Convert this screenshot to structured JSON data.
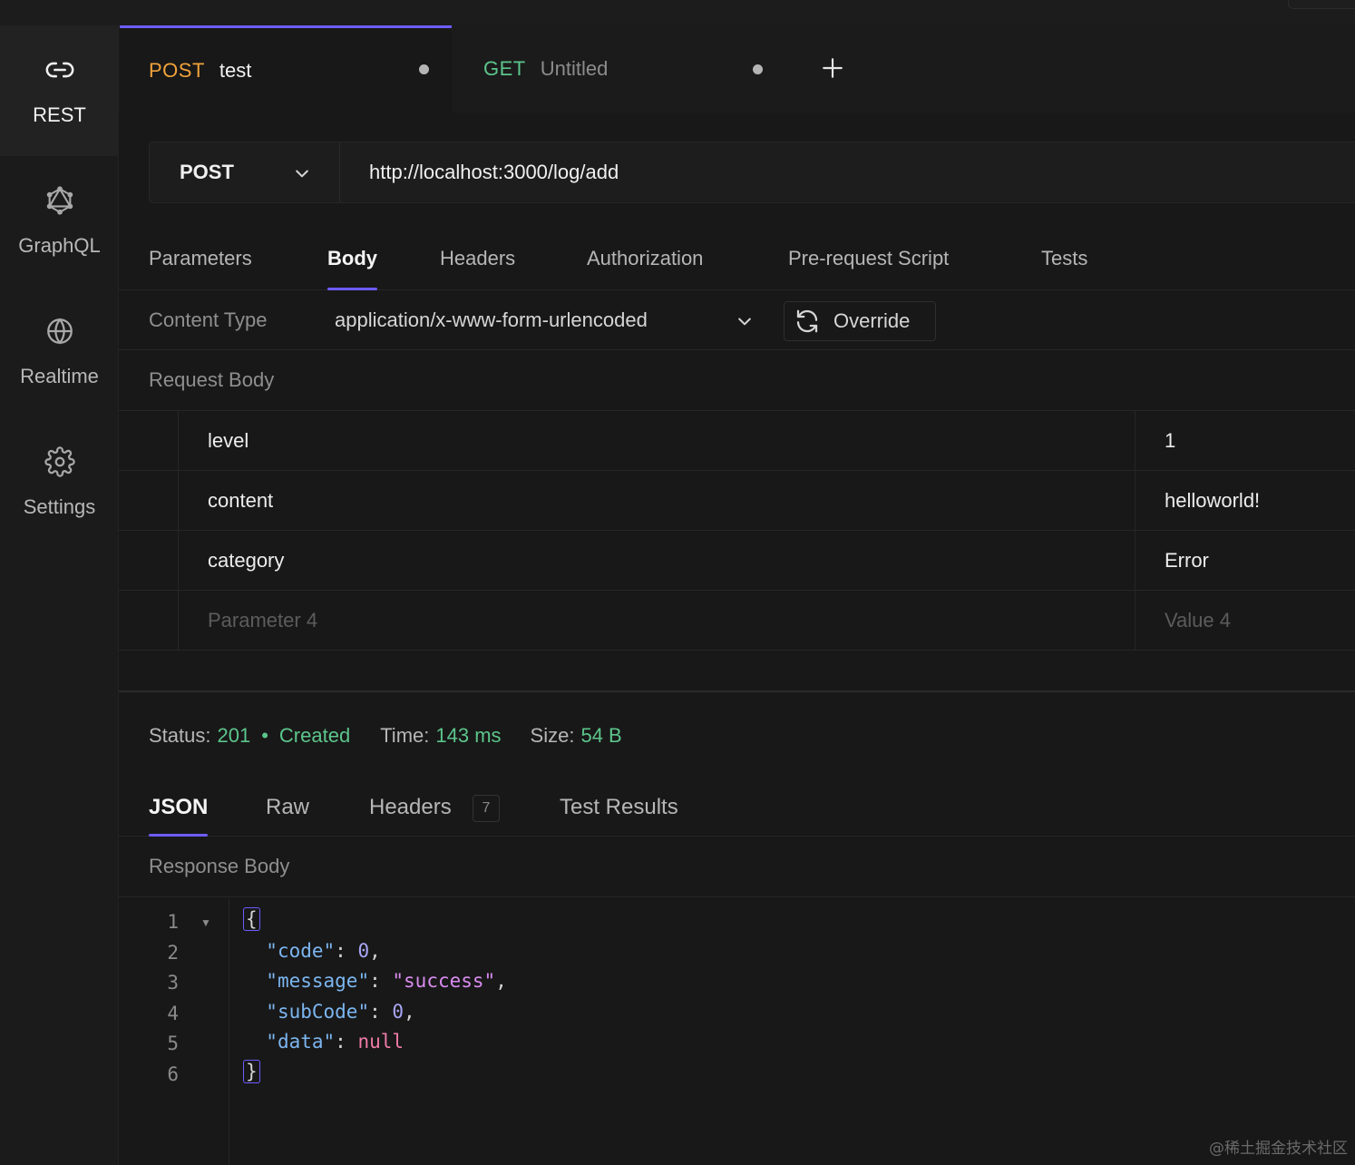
{
  "sidebar": {
    "items": [
      {
        "label": "REST",
        "icon": "link-icon",
        "active": true
      },
      {
        "label": "GraphQL",
        "icon": "graphql-icon",
        "active": false
      },
      {
        "label": "Realtime",
        "icon": "globe-icon",
        "active": false
      },
      {
        "label": "Settings",
        "icon": "gear-icon",
        "active": false
      }
    ]
  },
  "tabs": [
    {
      "method": "POST",
      "name": "test",
      "active": true,
      "method_color": "#f0a23b"
    },
    {
      "method": "GET",
      "name": "Untitled",
      "active": false,
      "method_color": "#5cc58b"
    }
  ],
  "request": {
    "method": "POST",
    "url": "http://localhost:3000/log/add"
  },
  "request_tabs": [
    "Parameters",
    "Body",
    "Headers",
    "Authorization",
    "Pre-request Script",
    "Tests"
  ],
  "active_request_tab": "Body",
  "content_type": {
    "label": "Content Type",
    "value": "application/x-www-form-urlencoded",
    "override_label": "Override"
  },
  "request_body": {
    "title": "Request Body",
    "rows": [
      {
        "key": "level",
        "value": "1"
      },
      {
        "key": "content",
        "value": "helloworld!"
      },
      {
        "key": "category",
        "value": "Error"
      },
      {
        "key": "Parameter 4",
        "value": "Value 4",
        "placeholder": true
      }
    ]
  },
  "response": {
    "status_label": "Status:",
    "status_code": "201",
    "status_sep": "•",
    "status_text": "Created",
    "time_label": "Time:",
    "time_value": "143 ms",
    "size_label": "Size:",
    "size_value": "54 B",
    "tabs": [
      "JSON",
      "Raw",
      "Headers",
      "Test Results"
    ],
    "headers_count": "7",
    "active_tab": "JSON",
    "body_title": "Response Body",
    "lines": [
      "1",
      "2",
      "3",
      "4",
      "5",
      "6"
    ],
    "json": {
      "open": "{",
      "close": "}",
      "k1": "\"code\"",
      "v1": "0",
      "k2": "\"message\"",
      "v2": "\"success\"",
      "k3": "\"subCode\"",
      "v3": "0",
      "k4": "\"data\"",
      "v4": "null"
    }
  },
  "colors": {
    "accent": "#6d5cff",
    "success": "#5cc58b",
    "post": "#f0a23b"
  },
  "watermark": "@稀土掘金技术社区"
}
